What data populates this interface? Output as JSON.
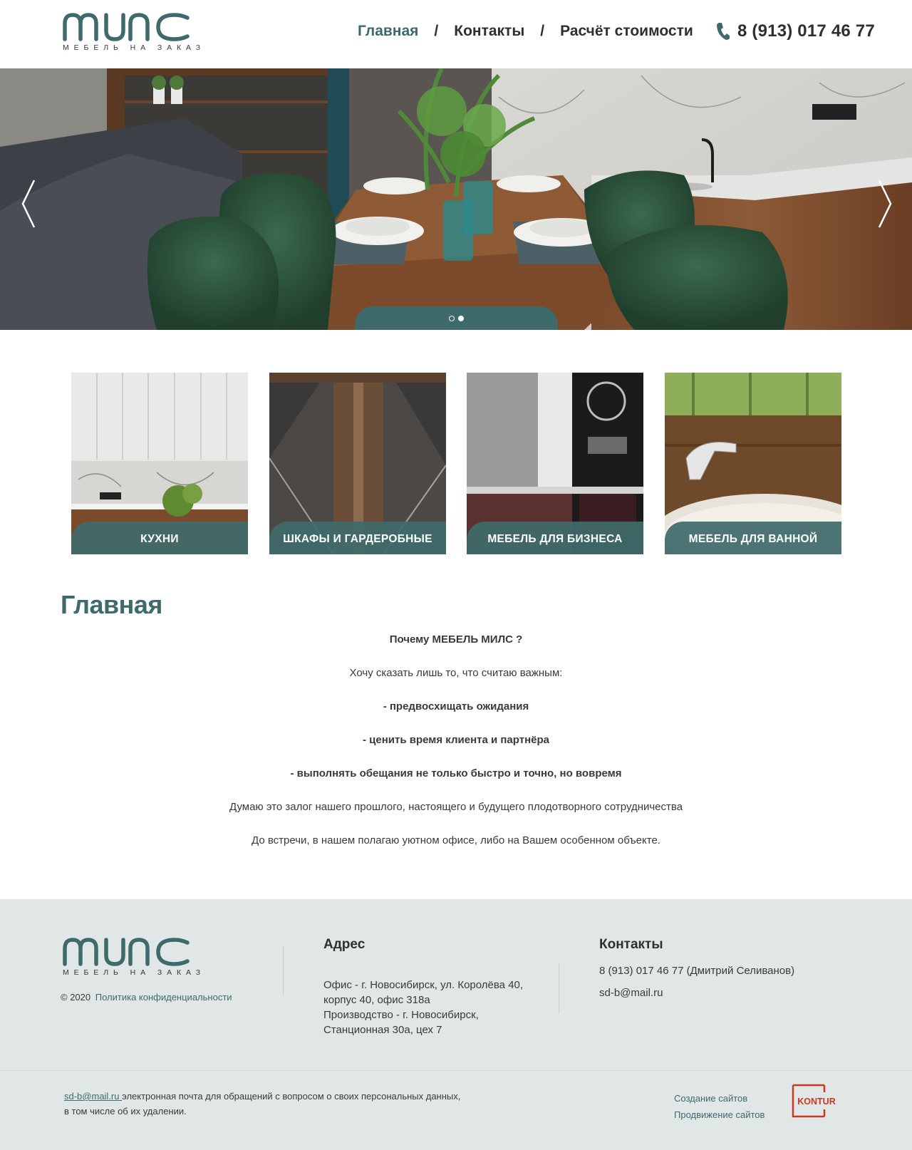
{
  "header": {
    "logo_tagline": "МЕБЕЛЬ НА ЗАКАЗ",
    "nav": [
      {
        "label": "Главная",
        "active": true
      },
      {
        "label": "Контакты",
        "active": false
      },
      {
        "label": "Расчёт стоимости",
        "active": false
      }
    ],
    "nav_separator": "/",
    "phone": "8 (913) 017 46 77"
  },
  "slider": {
    "slide_count": 2,
    "active_slide": 2
  },
  "categories": [
    {
      "label": "КУХНИ"
    },
    {
      "label": "ШКАФЫ И ГАРДЕРОБНЫЕ"
    },
    {
      "label": "МЕБЕЛЬ ДЛЯ БИЗНЕСА"
    },
    {
      "label": "МЕБЕЛЬ ДЛЯ ВАННОЙ"
    }
  ],
  "main": {
    "title": "Главная",
    "paragraphs": [
      {
        "text": "Почему МЕБЕЛЬ МИЛС ?",
        "bold": true
      },
      {
        "text": "Хочу сказать лишь то, что считаю важным:",
        "bold": false
      },
      {
        "text": "- предвосхищать ожидания",
        "bold": true
      },
      {
        "text": "- ценить время клиента и партнёра",
        "bold": true
      },
      {
        "text": "- выполнять обещания не только быстро и точно, но вовремя",
        "bold": true
      },
      {
        "text": "Думаю это залог нашего прошлого, настоящего и будущего плодотворного сотрудничества",
        "bold": false
      },
      {
        "text": "До встречи, в нашем полагаю уютном офисе,  либо  на Вашем особенном объекте.",
        "bold": false
      }
    ]
  },
  "footer": {
    "logo_tagline": "МЕБЕЛЬ НА ЗАКАЗ",
    "copyright": "© 2020",
    "privacy_link": "Политика конфиденциальности",
    "address_heading": "Адрес",
    "address_lines": [
      "Офис - г. Новосибирск, ул. Королёва 40,",
      "корпус 40, офис 318а",
      "Производство - г. Новосибирск,",
      "Станционная 30а, цех 7"
    ],
    "contacts_heading": "Контакты",
    "contact_phone": "8 (913) 017 46 77 (Дмитрий Селиванов)",
    "contact_email": "sd-b@mail.ru",
    "note_email": "sd-b@mail.ru ",
    "note_text_1": " электронная почта для обращений с вопросом о своих персональных данных,",
    "note_text_2": "в том числе об их удалении.",
    "link_create": "Создание сайтов",
    "link_promo": "Продвижение сайтов",
    "kontur_label": "KONTUR"
  },
  "colors": {
    "brand": "#3f6a6b",
    "footer_bg": "#e1e6e6",
    "kontur": "#c8391f"
  }
}
